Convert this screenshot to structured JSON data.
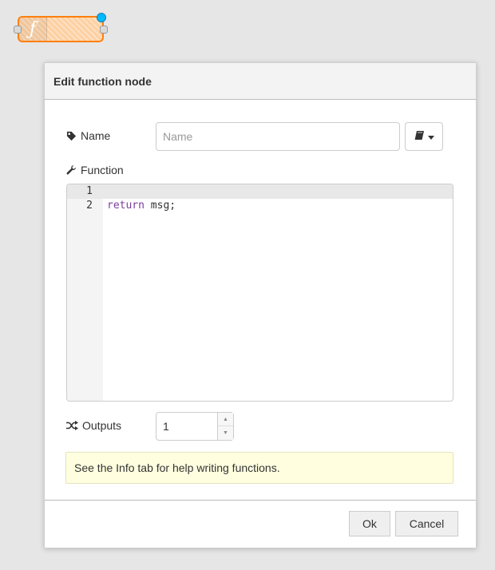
{
  "node": {
    "icon_glyph": "ƒ",
    "icon_name": "function-icon",
    "fill_color": "#fdd0a2",
    "border_color": "#ff7f0e",
    "changed_indicator_color": "#00bcff"
  },
  "dialog": {
    "title": "Edit function node",
    "name_field": {
      "label": "Name",
      "icon": "tag-icon",
      "value": "",
      "placeholder": "Name"
    },
    "library_button": {
      "icon": "book-icon",
      "dropdown_icon": "caret-down-icon"
    },
    "function_field": {
      "label": "Function",
      "icon": "wrench-icon",
      "lines": [
        {
          "number": "1",
          "keyword": "",
          "text": ""
        },
        {
          "number": "2",
          "keyword": "return",
          "text": " msg;"
        }
      ],
      "keyword_color": "#7a3e9d"
    },
    "outputs_field": {
      "label": "Outputs",
      "icon": "random-icon",
      "value": "1"
    },
    "tip": "See the Info tab for help writing functions.",
    "buttons": {
      "ok": "Ok",
      "cancel": "Cancel"
    }
  }
}
